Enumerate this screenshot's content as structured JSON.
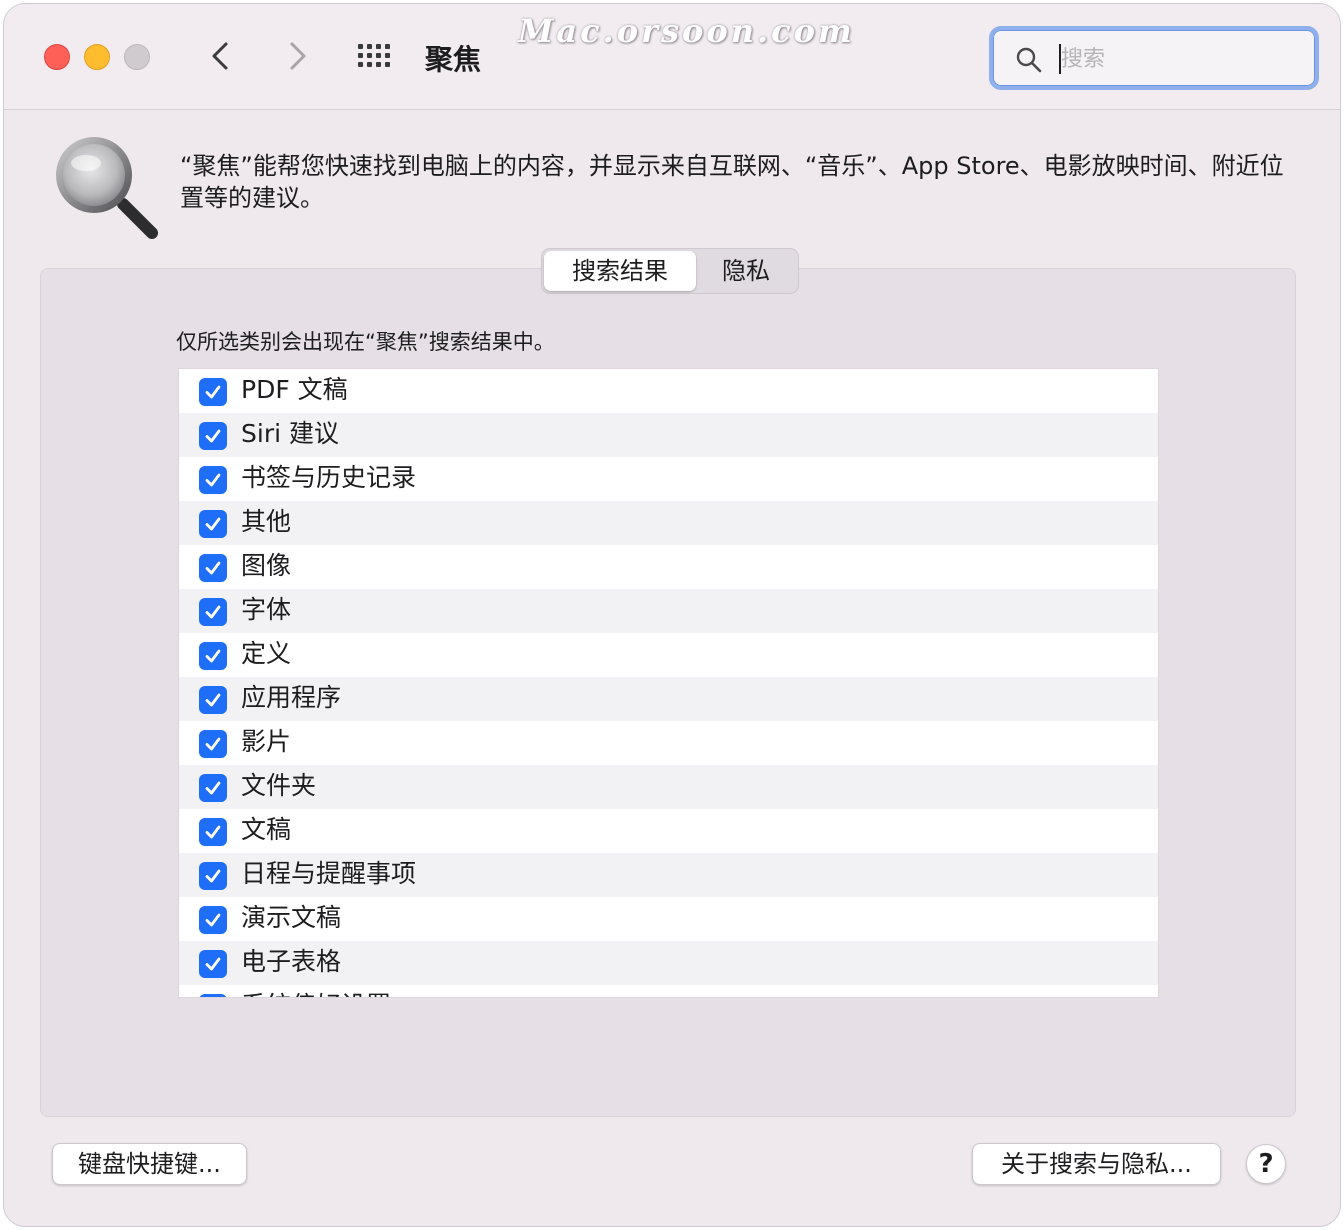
{
  "window": {
    "title": "聚焦",
    "watermark": "Mac.orsoon.com"
  },
  "toolbar": {
    "back_icon": "chevron-left-icon",
    "forward_icon": "chevron-right-icon",
    "grid_icon": "grid-icon"
  },
  "search": {
    "placeholder": "搜索",
    "value": ""
  },
  "intro": {
    "text": "“聚焦”能帮您快速找到电脑上的内容，并显示来自互联网、“音乐”、App Store、电影放映时间、附近位置等的建议。"
  },
  "tabs": [
    {
      "label": "搜索结果",
      "selected": true
    },
    {
      "label": "隐私",
      "selected": false
    }
  ],
  "panel": {
    "note": "仅所选类别会出现在“聚焦”搜索结果中。"
  },
  "categories": [
    {
      "label": "PDF 文稿",
      "checked": true
    },
    {
      "label": "Siri 建议",
      "checked": true
    },
    {
      "label": "书签与历史记录",
      "checked": true
    },
    {
      "label": "其他",
      "checked": true
    },
    {
      "label": "图像",
      "checked": true
    },
    {
      "label": "字体",
      "checked": true
    },
    {
      "label": "定义",
      "checked": true
    },
    {
      "label": "应用程序",
      "checked": true
    },
    {
      "label": "影片",
      "checked": true
    },
    {
      "label": "文件夹",
      "checked": true
    },
    {
      "label": "文稿",
      "checked": true
    },
    {
      "label": "日程与提醒事项",
      "checked": true
    },
    {
      "label": "演示文稿",
      "checked": true
    },
    {
      "label": "电子表格",
      "checked": true
    },
    {
      "label": "系统偏好设置",
      "checked": true
    }
  ],
  "buttons": {
    "shortcuts": "键盘快捷键...",
    "about": "关于搜索与隐私...",
    "help": "?"
  },
  "colors": {
    "accent": "#1f6ef7",
    "close": "#fe5f57",
    "minimize": "#febc2e",
    "zoom": "#cfcbcf"
  }
}
